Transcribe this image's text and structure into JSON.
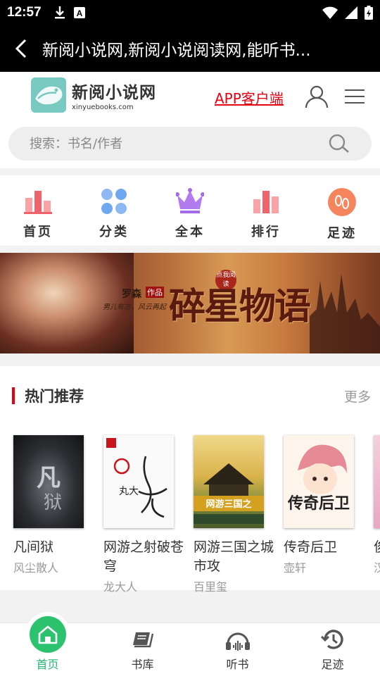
{
  "status_bar": {
    "time": "12:57"
  },
  "app_bar": {
    "title": "新阅小说网,新阅小说阅读网,能听书..."
  },
  "header": {
    "logo_name": "新阅小说网",
    "logo_domain": "xinyuebooks.com",
    "app_link": "APP客户端"
  },
  "search": {
    "placeholder": "搜索：书名/作者"
  },
  "nav": [
    {
      "label": "首页",
      "icon": "bar-chart-icon",
      "color": "#f0636b"
    },
    {
      "label": "分类",
      "icon": "grid-dots-icon",
      "color": "#6ea8f0"
    },
    {
      "label": "全本",
      "icon": "crown-icon",
      "color": "#a46ae8"
    },
    {
      "label": "排行",
      "icon": "bar-chart-icon",
      "color": "#f0636b"
    },
    {
      "label": "足迹",
      "icon": "footprints-icon",
      "color": "#f5855c"
    }
  ],
  "banner": {
    "author": "罗森",
    "tag": "作品",
    "slogan": "男儿有志，风云再起",
    "title": "碎星物语",
    "stamp": "点我阅读"
  },
  "hot": {
    "title": "热门推荐",
    "more": "更多",
    "books": [
      {
        "title": "凡间狱",
        "author": "风尘散人"
      },
      {
        "title": "网游之射破苍穹",
        "author": "龙大人"
      },
      {
        "title": "网游三国之城市攻",
        "author": "百里玺"
      },
      {
        "title": "传奇后卫",
        "author": "壶轩"
      },
      {
        "title": "俊是",
        "author": "汉"
      }
    ]
  },
  "tabbar": [
    {
      "label": "首页",
      "icon": "home-icon",
      "active": true
    },
    {
      "label": "书库",
      "icon": "bookshelf-icon"
    },
    {
      "label": "听书",
      "icon": "headphones-icon"
    },
    {
      "label": "足迹",
      "icon": "history-icon"
    }
  ]
}
